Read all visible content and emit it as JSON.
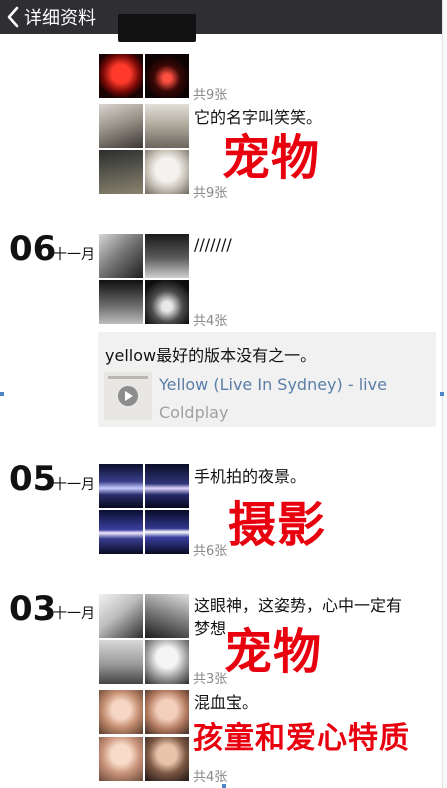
{
  "header": {
    "back_label": "详细资料"
  },
  "colors": {
    "topbar": "#2e2e33",
    "overlay": "#e8000f",
    "link": "#5b7ea8"
  },
  "posts": [
    {
      "count": "共9张"
    },
    {
      "caption": "它的名字叫笑笑。",
      "count": "共9张",
      "overlay": "宠物"
    },
    {
      "day": "06",
      "month": "十一月",
      "caption": "///////",
      "count": "共4张"
    },
    {
      "share_text": "yellow最好的版本没有之一。",
      "song_title": "Yellow (Live In Sydney) - live",
      "song_artist": "Coldplay",
      "icon": "play-icon"
    },
    {
      "day": "05",
      "month": "十一月",
      "caption": "手机拍的夜景。",
      "count": "共6张",
      "overlay": "摄影"
    },
    {
      "day": "03",
      "month": "十一月",
      "caption_line1": "这眼神，这姿势，心中一定有",
      "caption_line2": "梦想",
      "count": "共3张",
      "overlay": "宠物"
    },
    {
      "caption": "混血宝。",
      "count": "共4张",
      "overlay": "孩童和爱心特质"
    }
  ]
}
